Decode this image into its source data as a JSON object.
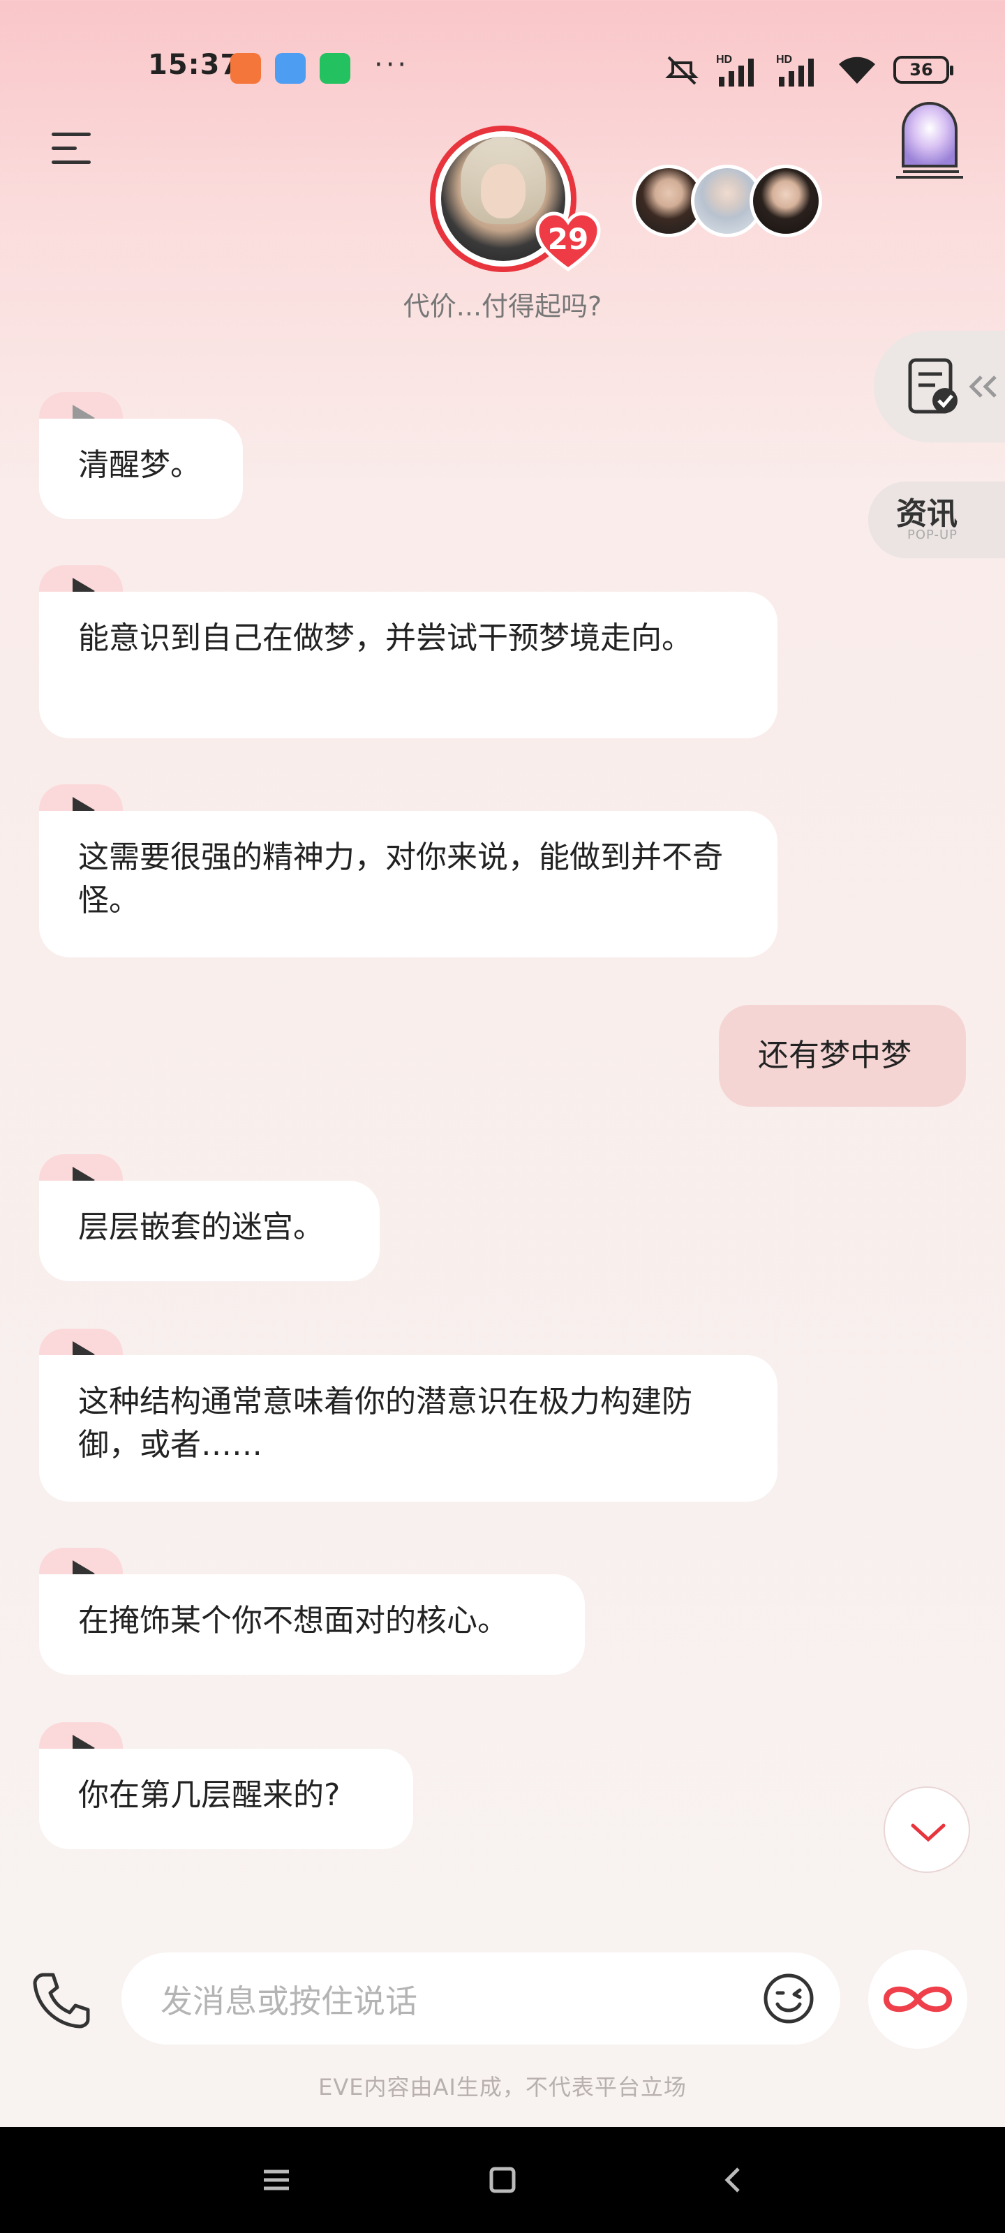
{
  "status_bar": {
    "time": "15:37",
    "battery": "36",
    "network_labels": [
      "HD",
      "HD"
    ]
  },
  "header": {
    "tagline": "代价...付得起吗?",
    "affection_count": "29"
  },
  "side_tabs": {
    "news_label": "资讯",
    "news_sublabel": "POP-UP"
  },
  "messages": [
    {
      "text": "清醒梦。"
    },
    {
      "text": "能意识到自己在做梦，并尝试干预梦境走向。"
    },
    {
      "text": "这需要很强的精神力，对你来说，能做到并不奇怪。"
    },
    {
      "text": "层层嵌套的迷宫。"
    },
    {
      "text": "这种结构通常意味着你的潜意识在极力构建防御，或者……"
    },
    {
      "text": "在掩饰某个你不想面对的核心。"
    },
    {
      "text": "你在第几层醒来的?"
    }
  ],
  "user_message": {
    "text": "还有梦中梦"
  },
  "input": {
    "placeholder": "发消息或按住说话"
  },
  "disclaimer": "EVE内容由AI生成，不代表平台立场",
  "colors": {
    "accent": "#e8343d",
    "bubble_user": "#f4d5d4",
    "play_tab": "#fbd9da"
  }
}
